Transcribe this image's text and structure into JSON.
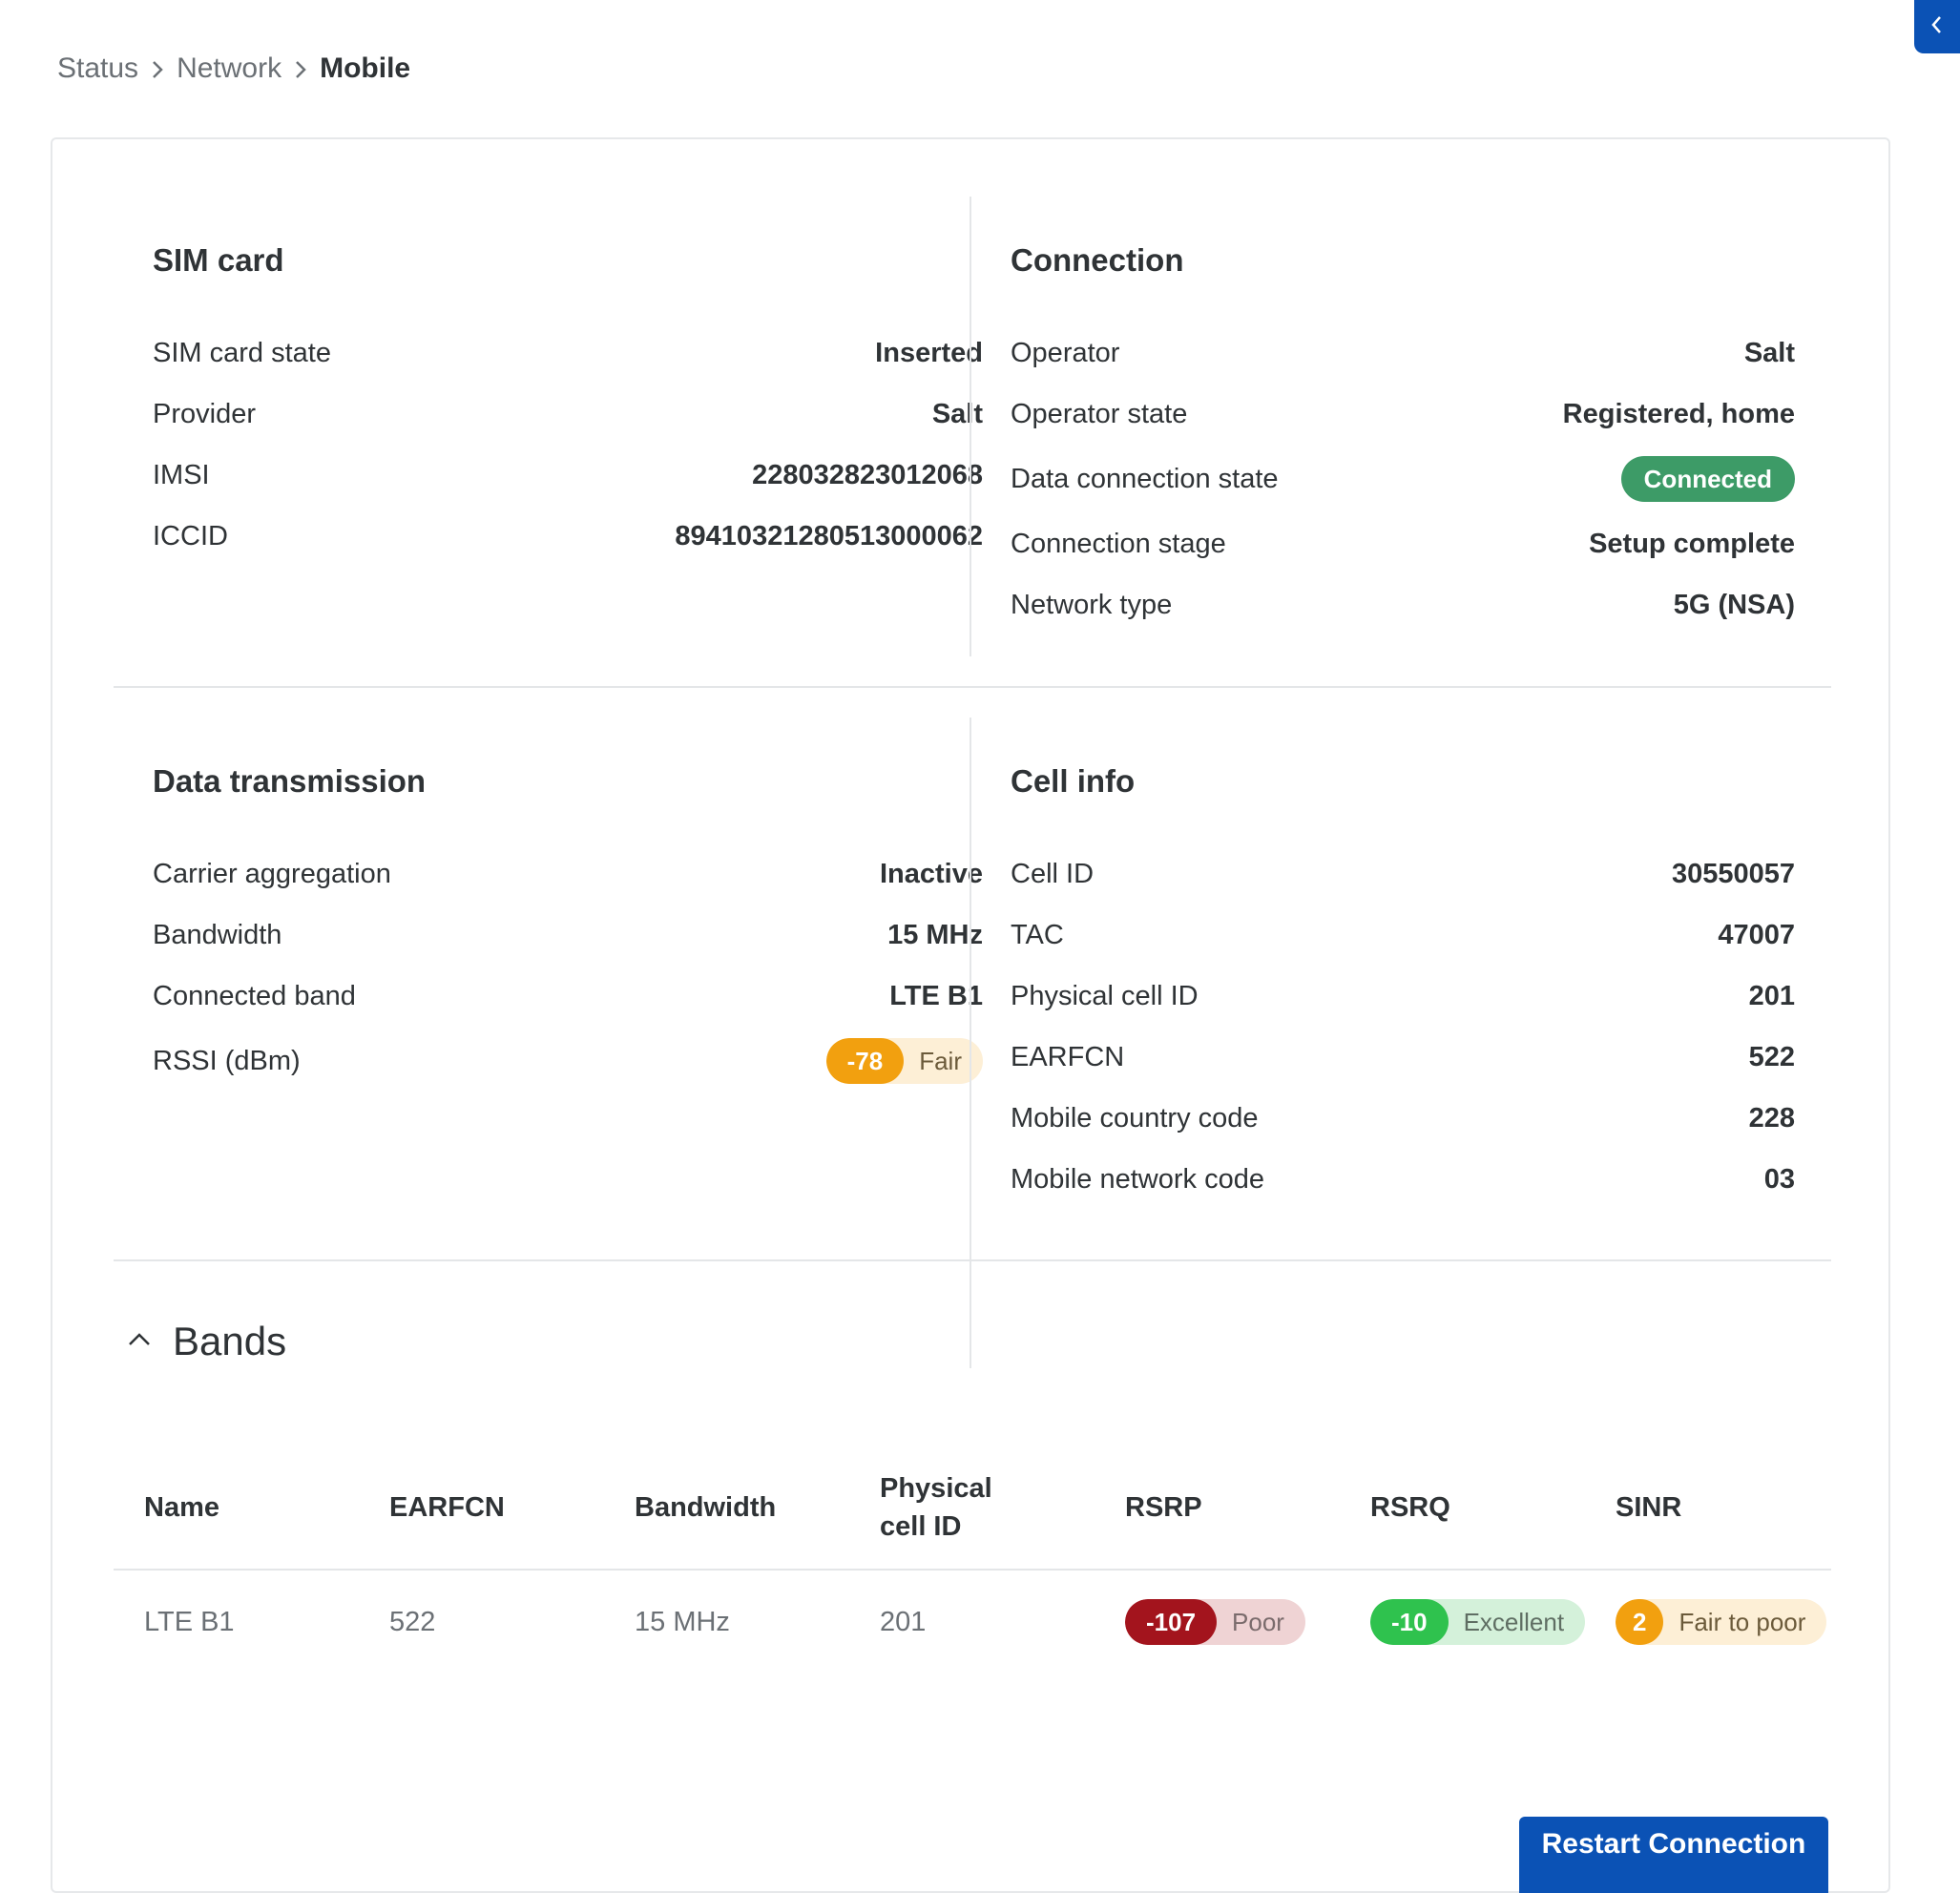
{
  "breadcrumb": {
    "items": [
      "Status",
      "Network",
      "Mobile"
    ]
  },
  "sim_card": {
    "title": "SIM card",
    "rows": [
      {
        "label": "SIM card state",
        "value": "Inserted"
      },
      {
        "label": "Provider",
        "value": "Salt"
      },
      {
        "label": "IMSI",
        "value": "228032823012068"
      },
      {
        "label": "ICCID",
        "value": "89410321280513000062"
      }
    ]
  },
  "connection": {
    "title": "Connection",
    "rows": [
      {
        "label": "Operator",
        "value": "Salt"
      },
      {
        "label": "Operator state",
        "value": "Registered, home"
      },
      {
        "label": "Data connection state",
        "value": "Connected"
      },
      {
        "label": "Connection stage",
        "value": "Setup complete"
      },
      {
        "label": "Network type",
        "value": "5G (NSA)"
      }
    ]
  },
  "data_transmission": {
    "title": "Data transmission",
    "rows": [
      {
        "label": "Carrier aggregation",
        "value": "Inactive"
      },
      {
        "label": "Bandwidth",
        "value": "15 MHz"
      },
      {
        "label": "Connected band",
        "value": "LTE B1"
      },
      {
        "label": "RSSI (dBm)",
        "value": "-78",
        "quality": "Fair"
      }
    ]
  },
  "cell_info": {
    "title": "Cell info",
    "rows": [
      {
        "label": "Cell ID",
        "value": "30550057"
      },
      {
        "label": "TAC",
        "value": "47007"
      },
      {
        "label": "Physical cell ID",
        "value": "201"
      },
      {
        "label": "EARFCN",
        "value": "522"
      },
      {
        "label": "Mobile country code",
        "value": "228"
      },
      {
        "label": "Mobile network code",
        "value": "03"
      }
    ]
  },
  "bands": {
    "title": "Bands",
    "columns": [
      "Name",
      "EARFCN",
      "Bandwidth",
      "Physical cell ID",
      "RSRP",
      "RSRQ",
      "SINR"
    ],
    "rows": [
      {
        "name": "LTE B1",
        "earfcn": "522",
        "bandwidth": "15 MHz",
        "pci": "201",
        "rsrp": {
          "value": "-107",
          "quality": "Poor"
        },
        "rsrq": {
          "value": "-10",
          "quality": "Excellent"
        },
        "sinr": {
          "value": "2",
          "quality": "Fair to poor"
        }
      }
    ]
  },
  "actions": {
    "restart_label": "Restart Connection"
  },
  "colors": {
    "primary": "#0b52b5",
    "connected": "#3d9b67",
    "fair": "#f2a00f",
    "fair_bg": "#fdefd6",
    "poor": "#a3141d",
    "poor_bg": "#efd3d4",
    "excellent": "#2fc24e",
    "excellent_bg": "#d4f1da"
  },
  "icons": {
    "breadcrumb_separator": "chevron-right-icon",
    "bands_toggle": "chevron-up-icon",
    "side_tab": "chevron-left-icon"
  }
}
